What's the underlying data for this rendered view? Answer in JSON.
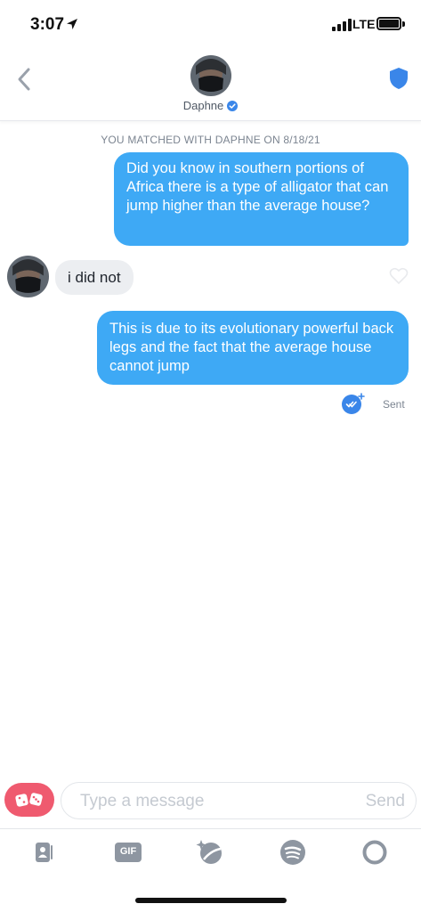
{
  "status_bar": {
    "time": "3:07",
    "network": "LTE"
  },
  "header": {
    "name": "Daphne"
  },
  "chat": {
    "match_notice": "YOU MATCHED WITH DAPHNE ON 8/18/21",
    "messages": [
      {
        "direction": "outgoing",
        "text": "Did you know in southern portions of Africa there is a type of alligator that can jump higher than the average house?"
      },
      {
        "direction": "incoming",
        "text": "i did not"
      },
      {
        "direction": "outgoing",
        "text": "This is due to its evolutionary powerful back legs and the fact that the average house cannot jump"
      }
    ],
    "sent_status": "Sent"
  },
  "composer": {
    "placeholder": "Type a message",
    "send_label": "Send"
  },
  "tray": {
    "gif_label": "GIF"
  },
  "colors": {
    "accent_blue": "#3ea9f5",
    "dice_red": "#ef5a6f",
    "shield_blue": "#3a86e9"
  }
}
